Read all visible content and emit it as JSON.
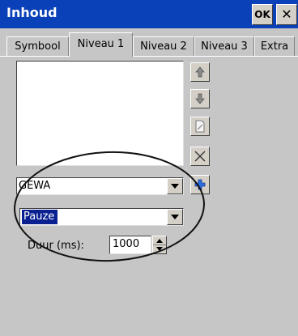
{
  "window": {
    "title": "Inhoud",
    "ok_label": "OK",
    "close_glyph": "✕"
  },
  "tabs": [
    {
      "label": "Symbool",
      "active": false
    },
    {
      "label": "Niveau 1",
      "active": true
    },
    {
      "label": "Niveau 2",
      "active": false
    },
    {
      "label": "Niveau 3",
      "active": false
    },
    {
      "label": "Extra",
      "active": false
    }
  ],
  "side_buttons": [
    "move-up-icon",
    "move-down-icon",
    "edit-document-icon",
    "delete-x-icon",
    "add-plus-icon"
  ],
  "level1_select": {
    "value": "GEWA"
  },
  "level2_select": {
    "value": "Pauze"
  },
  "duration": {
    "label": "Duur (ms):",
    "value": "1000"
  },
  "colors": {
    "titlebar": "#0a40b8",
    "background": "#c6c6c6",
    "selection": "#0a2090",
    "add_icon": "#2a6ee0"
  }
}
